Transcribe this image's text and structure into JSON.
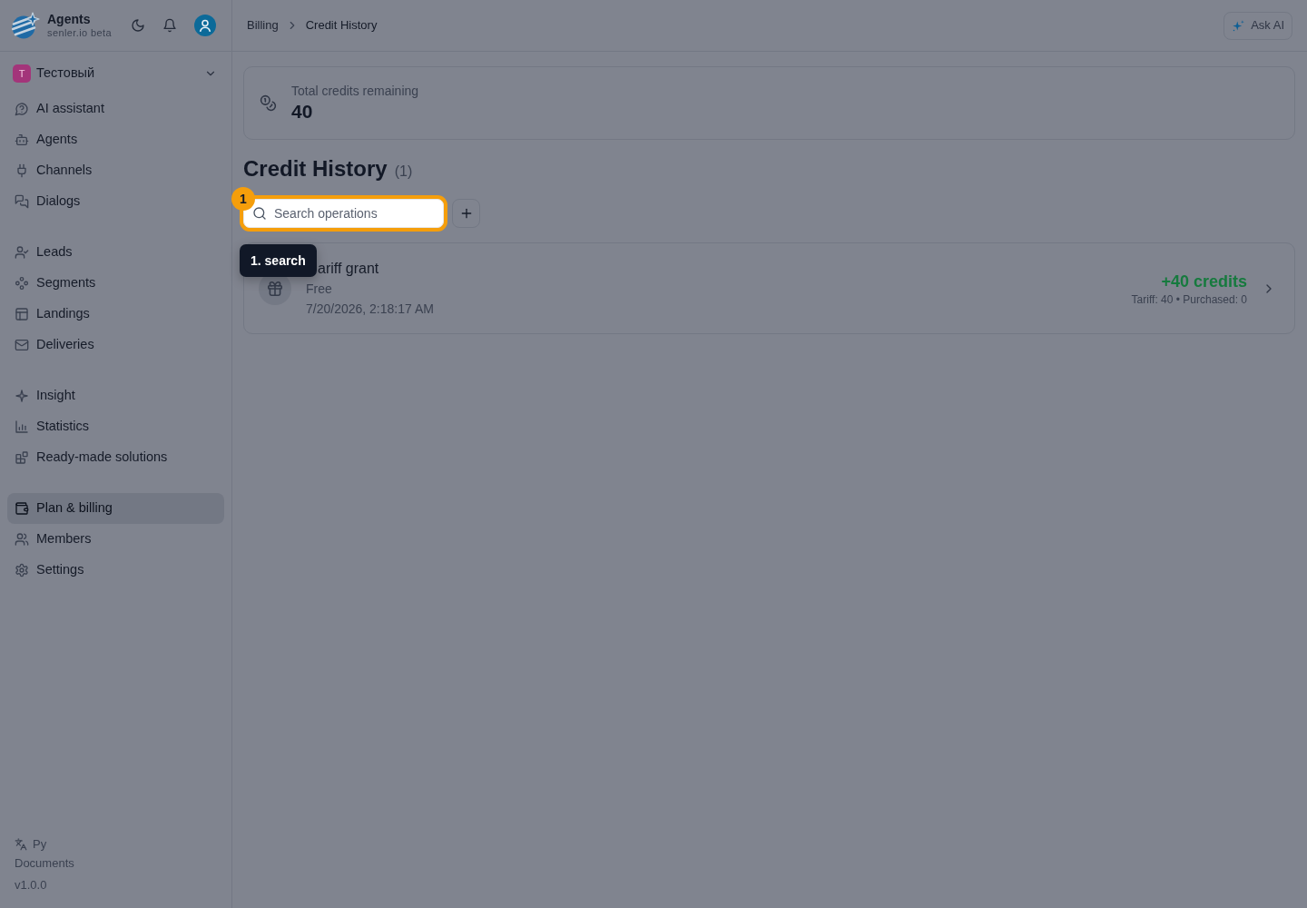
{
  "sidebar": {
    "brand": {
      "title": "Agents",
      "subtitle": "senler.io beta"
    },
    "workspace": {
      "initial": "T",
      "name": "Тестовый"
    },
    "nav_groups": [
      {
        "items": [
          {
            "label": "AI assistant",
            "selected": false
          },
          {
            "label": "Agents",
            "selected": false
          },
          {
            "label": "Channels",
            "selected": false
          },
          {
            "label": "Dialogs",
            "selected": false
          }
        ]
      },
      {
        "items": [
          {
            "label": "Leads",
            "selected": false
          },
          {
            "label": "Segments",
            "selected": false
          },
          {
            "label": "Landings",
            "selected": false
          },
          {
            "label": "Deliveries",
            "selected": false
          }
        ]
      },
      {
        "items": [
          {
            "label": "Insight",
            "selected": false
          },
          {
            "label": "Statistics",
            "selected": false
          },
          {
            "label": "Ready-made solutions",
            "selected": false
          }
        ]
      },
      {
        "items": [
          {
            "label": "Plan & billing",
            "selected": true
          },
          {
            "label": "Members",
            "selected": false
          },
          {
            "label": "Settings",
            "selected": false
          }
        ]
      }
    ],
    "footer": {
      "language": "Ру",
      "documents": "Documents",
      "version": "v1.0.0"
    }
  },
  "header": {
    "breadcrumb": [
      "Billing",
      "Credit History"
    ],
    "ask_ai": "Ask AI"
  },
  "credits": {
    "label": "Total credits remaining",
    "value": "40"
  },
  "history": {
    "title": "Credit History",
    "count": "(1)",
    "search": {
      "placeholder": "Search operations"
    },
    "operations": [
      {
        "title": "ariff grant",
        "plan": "Free",
        "date": "7/20/2026, 2:18:17 AM",
        "amount": "+40 credits",
        "breakdown": "Tariff: 40 • Purchased: 0"
      }
    ]
  },
  "tour": {
    "step": "1",
    "tooltip": "1. search"
  }
}
